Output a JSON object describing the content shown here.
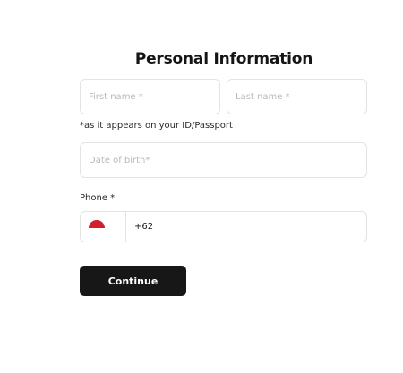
{
  "form": {
    "title": "Personal Information",
    "first_name": {
      "placeholder": "First name *",
      "value": ""
    },
    "last_name": {
      "placeholder": "Last name *",
      "value": ""
    },
    "id_hint": "*as it appears on your ID/Passport",
    "date_of_birth": {
      "placeholder": "Date of birth*",
      "value": ""
    },
    "phone": {
      "label": "Phone *",
      "country_flag": "indonesia-flag-icon",
      "value": "+62"
    },
    "continue_label": "Continue"
  },
  "colors": {
    "primary_button": "#171717",
    "border": "#e3e3e3",
    "placeholder": "#b9b9b9",
    "flag_red": "#d21f2b"
  }
}
